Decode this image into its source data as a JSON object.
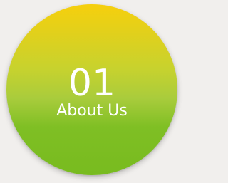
{
  "tile": {
    "number": "01",
    "label": "About Us"
  },
  "colors": {
    "background": "#f1efed",
    "gradient_top": "#f6cf0d",
    "gradient_bottom": "#78bb1f",
    "text": "#ffffff"
  }
}
